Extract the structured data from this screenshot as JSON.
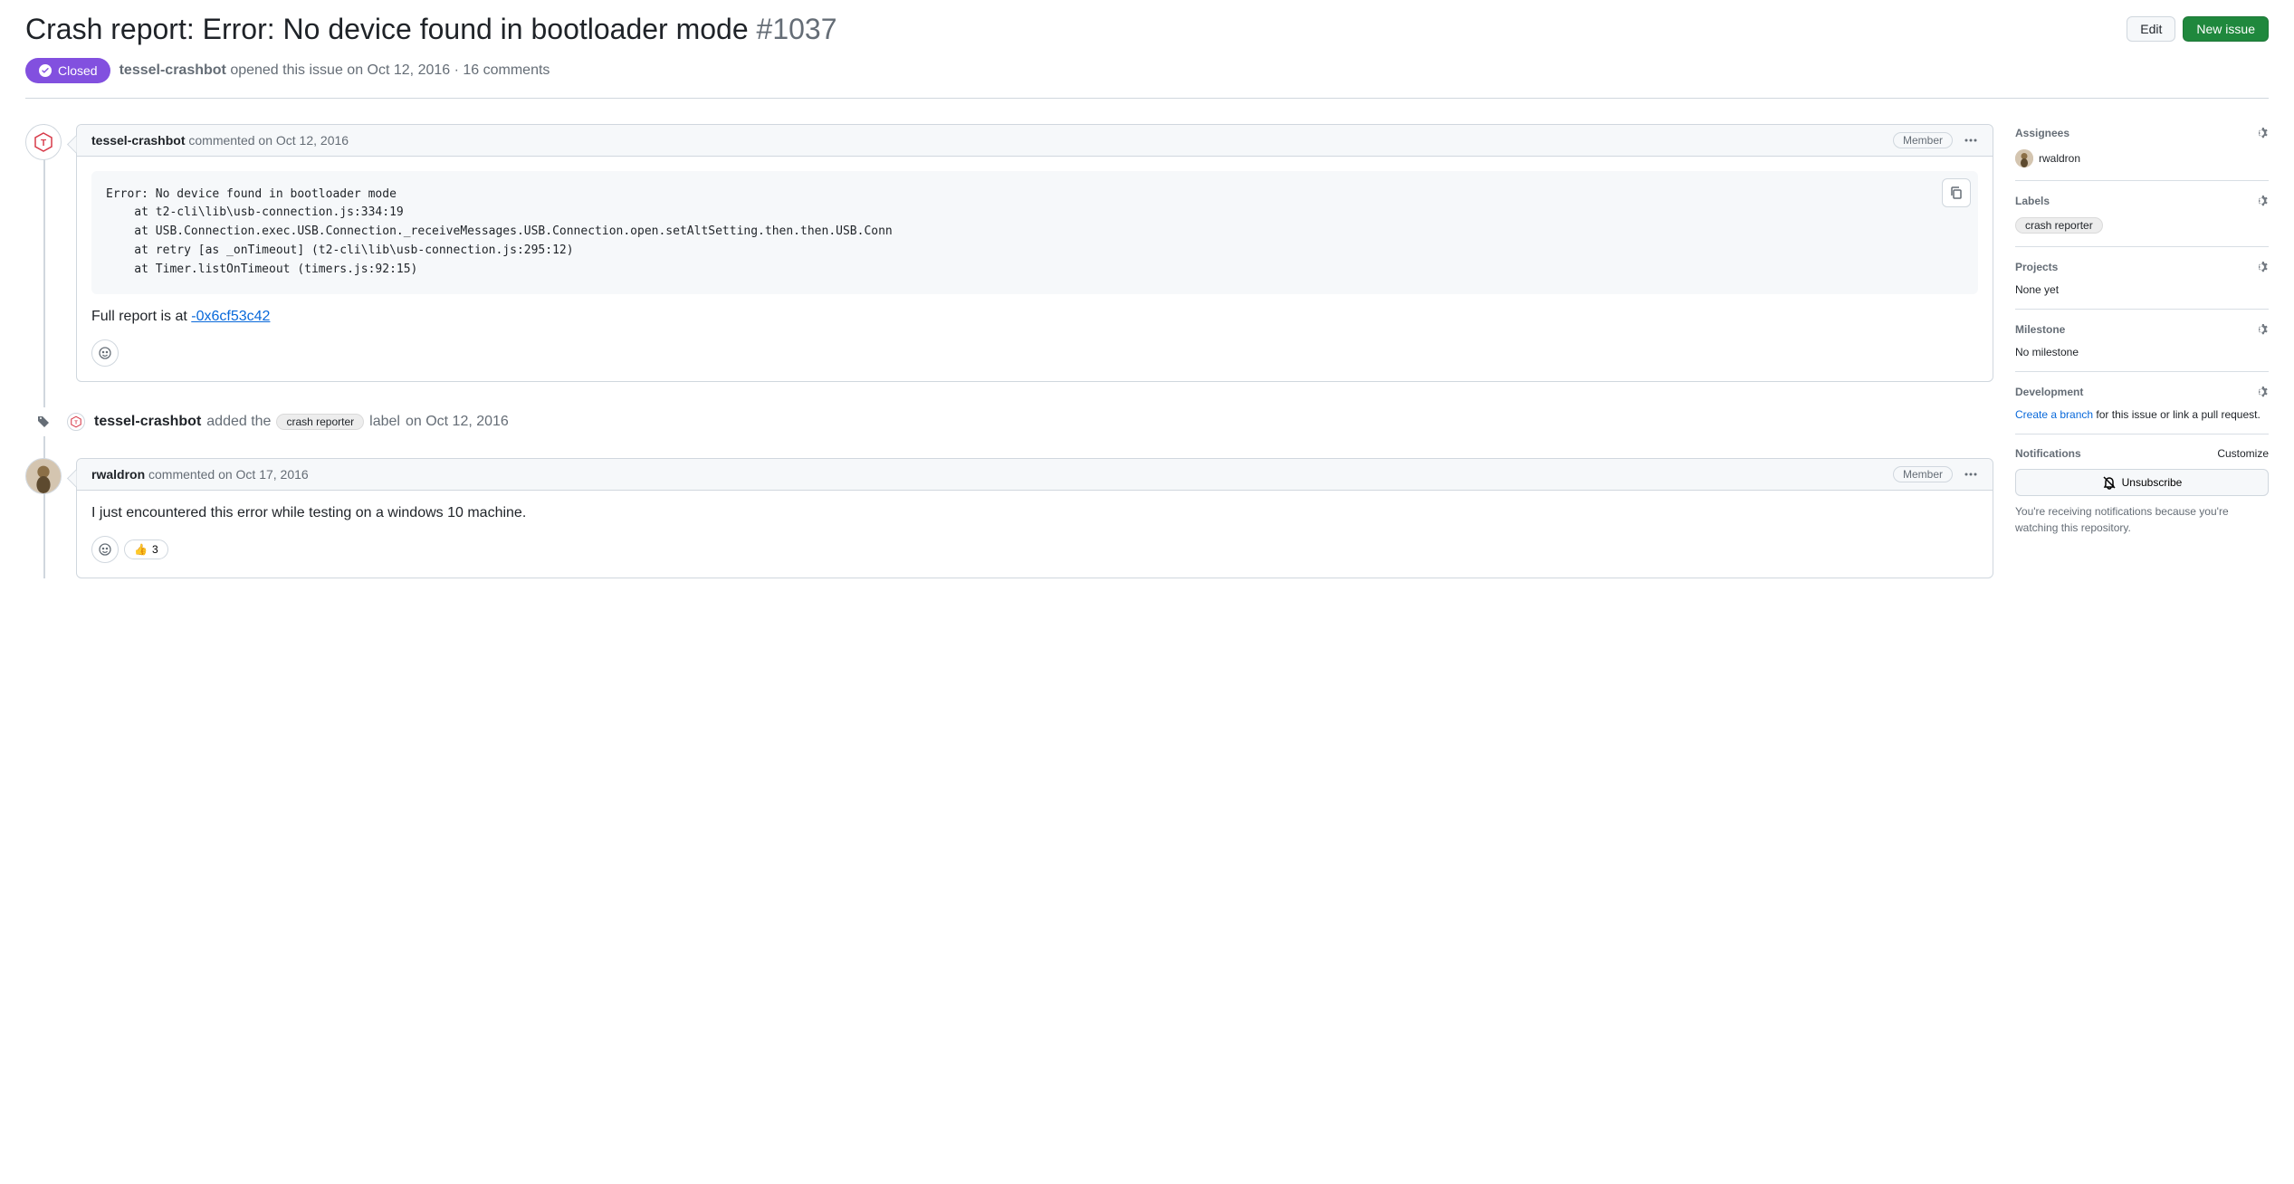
{
  "issue": {
    "title": "Crash report: Error: No device found in bootloader mode",
    "number": "#1037",
    "state": "Closed",
    "author": "tessel-crashbot",
    "openedText": "opened this issue",
    "date": "on Oct 12, 2016",
    "commentCount": "16 comments"
  },
  "buttons": {
    "edit": "Edit",
    "newIssue": "New issue"
  },
  "comments": [
    {
      "author": "tessel-crashbot",
      "action": "commented",
      "date": "on Oct 12, 2016",
      "role": "Member",
      "codeBlock": "Error: No device found in bootloader mode\n    at t2-cli\\lib\\usb-connection.js:334:19\n    at USB.Connection.exec.USB.Connection._receiveMessages.USB.Connection.open.setAltSetting.then.then.USB.Conn\n    at retry [as _onTimeout] (t2-cli\\lib\\usb-connection.js:295:12)\n    at Timer.listOnTimeout (timers.js:92:15)",
      "bodyPrefix": "Full report is at ",
      "bodyLink": "-0x6cf53c42"
    },
    {
      "author": "rwaldron",
      "action": "commented",
      "date": "on Oct 17, 2016",
      "role": "Member",
      "body": "I just encountered this error while testing on a windows 10 machine.",
      "reaction": {
        "emoji": "👍",
        "count": "3"
      }
    }
  ],
  "event": {
    "author": "tessel-crashbot",
    "action1": "added the",
    "label": "crash reporter",
    "action2": "label",
    "date": "on Oct 12, 2016"
  },
  "sidebar": {
    "assignees": {
      "title": "Assignees",
      "name": "rwaldron"
    },
    "labels": {
      "title": "Labels",
      "label": "crash reporter"
    },
    "projects": {
      "title": "Projects",
      "value": "None yet"
    },
    "milestone": {
      "title": "Milestone",
      "value": "No milestone"
    },
    "development": {
      "title": "Development",
      "link": "Create a branch",
      "rest": " for this issue or link a pull request."
    },
    "notifications": {
      "title": "Notifications",
      "customize": "Customize",
      "unsubscribe": "Unsubscribe",
      "reason": "You're receiving notifications because you're watching this repository."
    }
  }
}
